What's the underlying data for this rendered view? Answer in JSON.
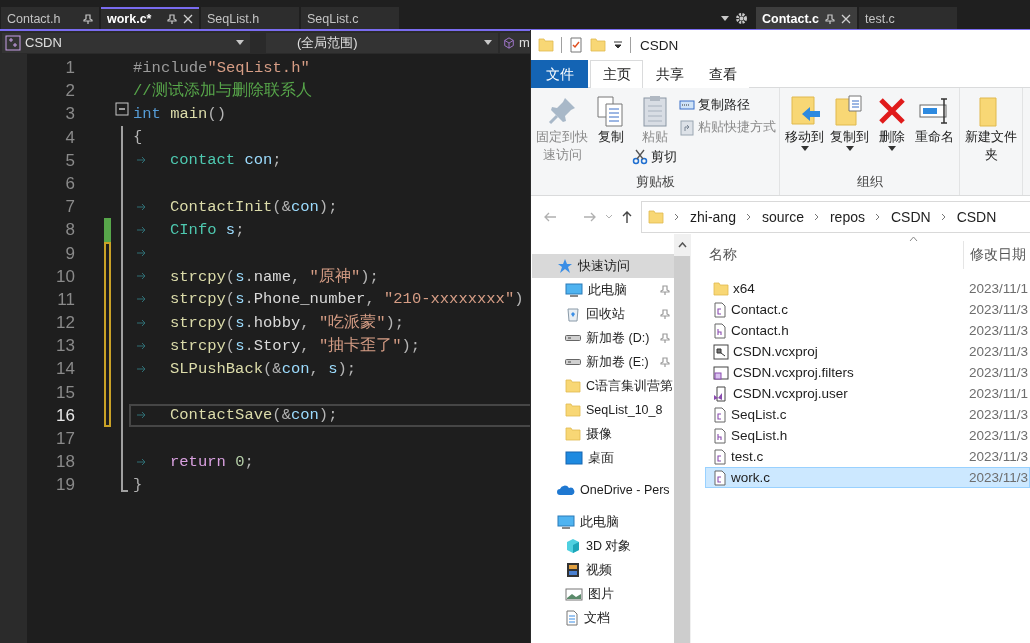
{
  "editor": {
    "tab_groups": [
      {
        "focused": true,
        "tabs": [
          {
            "label": "Contact.h",
            "selected": false,
            "pin_button": true
          },
          {
            "label": "work.c*",
            "selected": true,
            "pin_button": true
          },
          {
            "label": "SeqList.h",
            "selected": false,
            "pin_button": false
          },
          {
            "label": "SeqList.c",
            "selected": false,
            "pin_button": false
          }
        ]
      },
      {
        "focused": false,
        "tabs": [
          {
            "label": "Contact.c",
            "selected": true,
            "pin_button": true
          },
          {
            "label": "test.c",
            "selected": false,
            "pin_button": false
          }
        ]
      }
    ],
    "navigation_bar": {
      "project": "CSDN",
      "scope": "(全局范围)",
      "member": "m"
    },
    "lines": [
      {
        "number": "1",
        "indented": false,
        "collapse_button": false,
        "saved_change": false,
        "unsaved_change": false,
        "current": false,
        "tokens": [
          {
            "text": "#include",
            "kind": "preprocessor"
          },
          {
            "text": "\"SeqList.h\"",
            "kind": "string"
          }
        ]
      },
      {
        "number": "2",
        "indented": false,
        "collapse_button": false,
        "saved_change": false,
        "unsaved_change": false,
        "current": false,
        "tokens": [
          {
            "text": "//测试添加与删除联系人",
            "kind": "comment"
          }
        ]
      },
      {
        "number": "3",
        "indented": false,
        "collapse_button": true,
        "saved_change": false,
        "unsaved_change": false,
        "current": false,
        "tokens": [
          {
            "text": "int ",
            "kind": "keyword"
          },
          {
            "text": "main",
            "kind": "function"
          },
          {
            "text": "()",
            "kind": "punctuation"
          }
        ]
      },
      {
        "number": "4",
        "indented": false,
        "collapse_button": false,
        "saved_change": false,
        "unsaved_change": false,
        "current": false,
        "tokens": [
          {
            "text": "{",
            "kind": "punctuation"
          }
        ]
      },
      {
        "number": "5",
        "indented": true,
        "collapse_button": false,
        "saved_change": false,
        "unsaved_change": false,
        "current": false,
        "tokens": [
          {
            "text": "contact ",
            "kind": "type"
          },
          {
            "text": "con",
            "kind": "variable"
          },
          {
            "text": ";",
            "kind": "punctuation"
          }
        ]
      },
      {
        "number": "6",
        "indented": false,
        "collapse_button": false,
        "saved_change": false,
        "unsaved_change": false,
        "current": false
      },
      {
        "number": "7",
        "indented": true,
        "collapse_button": false,
        "saved_change": false,
        "unsaved_change": false,
        "current": false,
        "tokens": [
          {
            "text": "ContactInit",
            "kind": "function"
          },
          {
            "text": "(&",
            "kind": "punctuation"
          },
          {
            "text": "con",
            "kind": "variable"
          },
          {
            "text": ");",
            "kind": "punctuation"
          }
        ]
      },
      {
        "number": "8",
        "indented": true,
        "collapse_button": false,
        "saved_change": true,
        "unsaved_change": false,
        "current": false,
        "tokens": [
          {
            "text": "CInfo ",
            "kind": "type"
          },
          {
            "text": "s",
            "kind": "variable"
          },
          {
            "text": ";",
            "kind": "punctuation"
          }
        ]
      },
      {
        "number": "9",
        "indented": true,
        "collapse_button": false,
        "saved_change": false,
        "unsaved_change": true,
        "current": false
      },
      {
        "number": "10",
        "indented": true,
        "collapse_button": false,
        "saved_change": false,
        "unsaved_change": true,
        "current": false,
        "tokens": [
          {
            "text": "strcpy",
            "kind": "function"
          },
          {
            "text": "(",
            "kind": "punctuation"
          },
          {
            "text": "s",
            "kind": "variable"
          },
          {
            "text": ".",
            "kind": "punctuation"
          },
          {
            "text": "name",
            "kind": "member"
          },
          {
            "text": ", ",
            "kind": "punctuation"
          },
          {
            "text": "\"原神\"",
            "kind": "string"
          },
          {
            "text": ");",
            "kind": "punctuation"
          }
        ]
      },
      {
        "number": "11",
        "indented": true,
        "collapse_button": false,
        "saved_change": false,
        "unsaved_change": true,
        "current": false,
        "tokens": [
          {
            "text": "strcpy",
            "kind": "function"
          },
          {
            "text": "(",
            "kind": "punctuation"
          },
          {
            "text": "s",
            "kind": "variable"
          },
          {
            "text": ".",
            "kind": "punctuation"
          },
          {
            "text": "Phone_number",
            "kind": "member"
          },
          {
            "text": ", ",
            "kind": "punctuation"
          },
          {
            "text": "\"210-xxxxxxxx\"",
            "kind": "string"
          },
          {
            "text": ")",
            "kind": "punctuation"
          }
        ]
      },
      {
        "number": "12",
        "indented": true,
        "collapse_button": false,
        "saved_change": false,
        "unsaved_change": true,
        "current": false,
        "tokens": [
          {
            "text": "strcpy",
            "kind": "function"
          },
          {
            "text": "(",
            "kind": "punctuation"
          },
          {
            "text": "s",
            "kind": "variable"
          },
          {
            "text": ".",
            "kind": "punctuation"
          },
          {
            "text": "hobby",
            "kind": "member"
          },
          {
            "text": ", ",
            "kind": "punctuation"
          },
          {
            "text": "\"吃派蒙\"",
            "kind": "string"
          },
          {
            "text": ");",
            "kind": "punctuation"
          }
        ]
      },
      {
        "number": "13",
        "indented": true,
        "collapse_button": false,
        "saved_change": false,
        "unsaved_change": true,
        "current": false,
        "tokens": [
          {
            "text": "strcpy",
            "kind": "function"
          },
          {
            "text": "(",
            "kind": "punctuation"
          },
          {
            "text": "s",
            "kind": "variable"
          },
          {
            "text": ".",
            "kind": "punctuation"
          },
          {
            "text": "Story",
            "kind": "member"
          },
          {
            "text": ", ",
            "kind": "punctuation"
          },
          {
            "text": "\"抽卡歪了\"",
            "kind": "string"
          },
          {
            "text": ");",
            "kind": "punctuation"
          }
        ]
      },
      {
        "number": "14",
        "indented": true,
        "collapse_button": false,
        "saved_change": false,
        "unsaved_change": true,
        "current": false,
        "tokens": [
          {
            "text": "SLPushBack",
            "kind": "function"
          },
          {
            "text": "(&",
            "kind": "punctuation"
          },
          {
            "text": "con",
            "kind": "variable"
          },
          {
            "text": ", ",
            "kind": "punctuation"
          },
          {
            "text": "s",
            "kind": "variable"
          },
          {
            "text": ");",
            "kind": "punctuation"
          }
        ]
      },
      {
        "number": "15",
        "indented": false,
        "collapse_button": false,
        "saved_change": false,
        "unsaved_change": true,
        "current": false
      },
      {
        "number": "16",
        "indented": true,
        "collapse_button": false,
        "saved_change": false,
        "unsaved_change": true,
        "current": true,
        "tokens": [
          {
            "text": "ContactSave",
            "kind": "function"
          },
          {
            "text": "(&",
            "kind": "punctuation"
          },
          {
            "text": "con",
            "kind": "variable"
          },
          {
            "text": ");",
            "kind": "punctuation"
          }
        ]
      },
      {
        "number": "17",
        "indented": false,
        "collapse_button": false,
        "saved_change": false,
        "unsaved_change": false,
        "current": false
      },
      {
        "number": "18",
        "indented": true,
        "collapse_button": false,
        "saved_change": false,
        "unsaved_change": false,
        "current": false,
        "tokens": [
          {
            "text": "return ",
            "kind": "control"
          },
          {
            "text": "0",
            "kind": "number"
          },
          {
            "text": ";",
            "kind": "punctuation"
          }
        ]
      },
      {
        "number": "19",
        "indented": false,
        "collapse_button": false,
        "saved_change": false,
        "unsaved_change": false,
        "current": false,
        "tokens": [
          {
            "text": "}",
            "kind": "punctuation"
          }
        ]
      }
    ]
  },
  "explorer": {
    "title": "CSDN",
    "ribbon_tabs": [
      {
        "label": "文件",
        "kind": "file",
        "selected": false
      },
      {
        "label": "主页",
        "kind": "tab",
        "selected": true
      },
      {
        "label": "共享",
        "kind": "tab",
        "selected": false
      },
      {
        "label": "查看",
        "kind": "tab",
        "selected": false
      }
    ],
    "ribbon_groups": [
      {
        "label": "剪贴板",
        "columns": [
          [
            {
              "label": "固定到快速访问",
              "kind": "large",
              "disabled": true,
              "menu": false
            }
          ],
          [
            {
              "label": "复制",
              "kind": "large",
              "disabled": false,
              "menu": false
            }
          ],
          [
            {
              "label": "粘贴",
              "kind": "large",
              "disabled": true,
              "menu": false
            },
            {
              "label": "剪切",
              "kind": "small",
              "disabled": false,
              "menu": false
            }
          ],
          [
            {
              "label": "复制路径",
              "kind": "small",
              "disabled": false,
              "menu": false
            },
            {
              "label": "粘贴快捷方式",
              "kind": "small",
              "disabled": true,
              "menu": false
            }
          ]
        ]
      },
      {
        "label": "组织",
        "columns": [
          [
            {
              "label": "移动到",
              "kind": "large",
              "disabled": false,
              "menu": true
            }
          ],
          [
            {
              "label": "复制到",
              "kind": "large",
              "disabled": false,
              "menu": true
            }
          ],
          [
            {
              "label": "删除",
              "kind": "large",
              "disabled": false,
              "menu": true
            }
          ],
          [
            {
              "label": "重命名",
              "kind": "large",
              "disabled": false,
              "menu": false
            }
          ]
        ]
      },
      {
        "columns": [
          [
            {
              "label": "新建文件夹",
              "kind": "large",
              "disabled": false,
              "menu": false
            }
          ]
        ]
      }
    ],
    "breadcrumbs": [
      "zhi-ang",
      "source",
      "repos",
      "CSDN",
      "CSDN"
    ],
    "navigation": [
      {
        "label": "快速访问",
        "kind": "star",
        "selected": true,
        "pinned": false,
        "children": [
          {
            "label": "此电脑",
            "kind": "computer",
            "selected": false,
            "pinned": true
          },
          {
            "label": "回收站",
            "kind": "recycle",
            "selected": false,
            "pinned": true
          },
          {
            "label": "新加卷 (D:)",
            "kind": "drive",
            "selected": false,
            "pinned": true
          },
          {
            "label": "新加卷 (E:)",
            "kind": "drive",
            "selected": false,
            "pinned": true
          },
          {
            "label": "C语言集训营第",
            "kind": "folder",
            "selected": false,
            "pinned": false
          },
          {
            "label": "SeqList_10_8",
            "kind": "folder",
            "selected": false,
            "pinned": false
          },
          {
            "label": "摄像",
            "kind": "folder",
            "selected": false,
            "pinned": false
          },
          {
            "label": "桌面",
            "kind": "desktop",
            "selected": false,
            "pinned": false
          }
        ]
      },
      {
        "label": "OneDrive - Pers",
        "kind": "cloud",
        "selected": false,
        "pinned": false
      },
      {
        "label": "此电脑",
        "kind": "computer",
        "selected": false,
        "pinned": false,
        "children": [
          {
            "label": "3D 对象",
            "kind": "cube",
            "selected": false,
            "pinned": false
          },
          {
            "label": "视频",
            "kind": "film",
            "selected": false,
            "pinned": false
          },
          {
            "label": "图片",
            "kind": "image",
            "selected": false,
            "pinned": false
          },
          {
            "label": "文档",
            "kind": "document",
            "selected": false,
            "pinned": false
          }
        ]
      }
    ],
    "columns": [
      "名称",
      "修改日期"
    ],
    "files": [
      {
        "name": "x64",
        "kind": "folder",
        "date": "2023/11/1",
        "selected": false
      },
      {
        "name": "Contact.c",
        "kind": "c",
        "date": "2023/11/3",
        "selected": false
      },
      {
        "name": "Contact.h",
        "kind": "h",
        "date": "2023/11/3",
        "selected": false
      },
      {
        "name": "CSDN.vcxproj",
        "kind": "project",
        "date": "2023/11/3",
        "selected": false
      },
      {
        "name": "CSDN.vcxproj.filters",
        "kind": "filters",
        "date": "2023/11/3",
        "selected": false
      },
      {
        "name": "CSDN.vcxproj.user",
        "kind": "user",
        "date": "2023/11/1",
        "selected": false
      },
      {
        "name": "SeqList.c",
        "kind": "c",
        "date": "2023/11/3",
        "selected": false
      },
      {
        "name": "SeqList.h",
        "kind": "h",
        "date": "2023/11/3",
        "selected": false
      },
      {
        "name": "test.c",
        "kind": "c",
        "date": "2023/11/3",
        "selected": false
      },
      {
        "name": "work.c",
        "kind": "c",
        "date": "2023/11/3",
        "selected": true
      }
    ]
  }
}
